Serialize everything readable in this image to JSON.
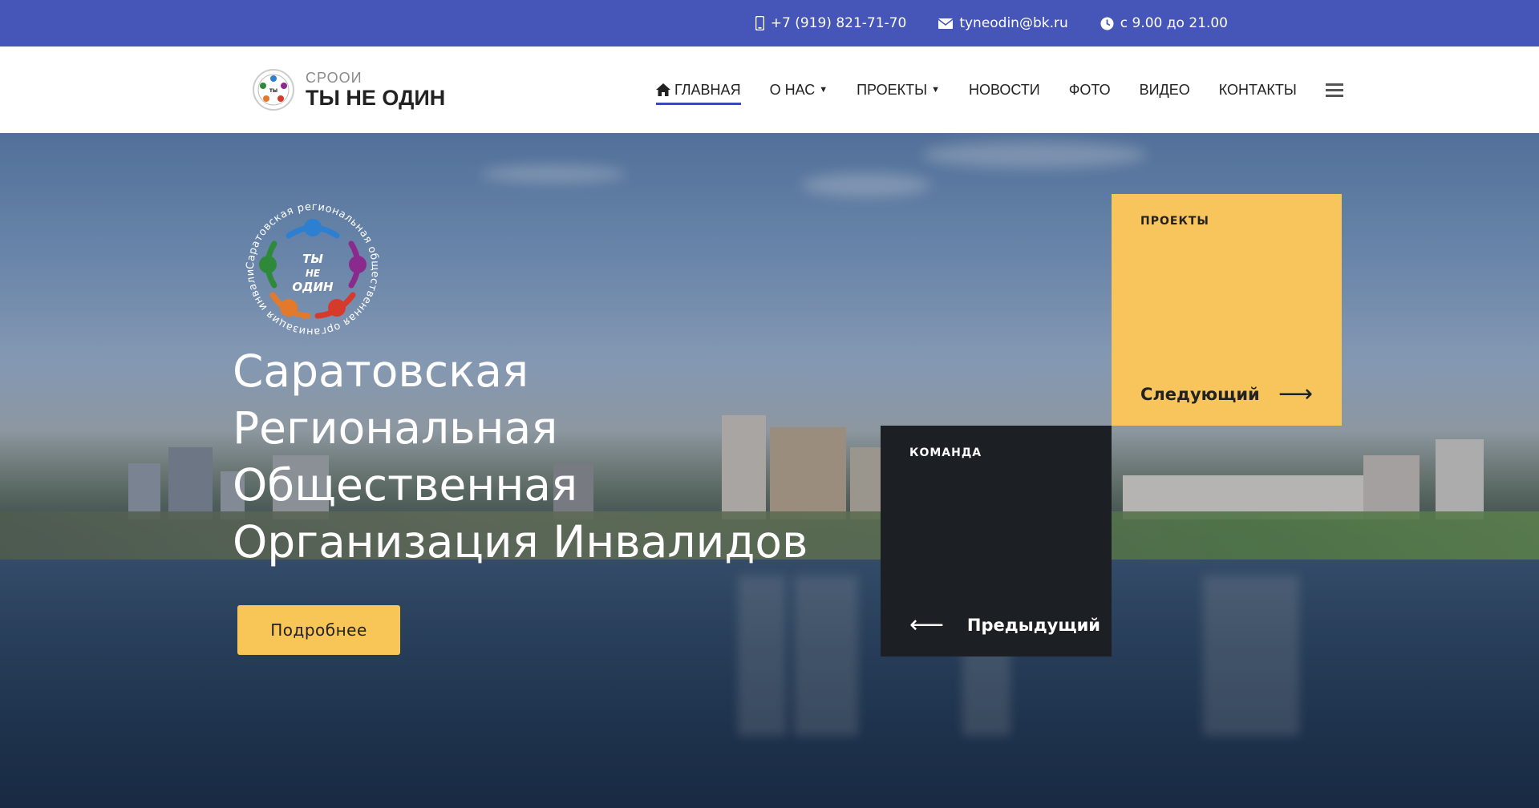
{
  "topbar": {
    "phone": "+7 (919) 821-71-70",
    "email": "tyneodin@bk.ru",
    "hours": "с 9.00 до 21.00"
  },
  "brand": {
    "small": "СРООИ",
    "big": "ТЫ НЕ ОДИН"
  },
  "nav": {
    "items": [
      {
        "label": "ГЛАВНАЯ",
        "icon": "home-icon",
        "active": true
      },
      {
        "label": "О НАС",
        "dropdown": true
      },
      {
        "label": "ПРОЕКТЫ",
        "dropdown": true
      },
      {
        "label": "НОВОСТИ"
      },
      {
        "label": "ФОТО"
      },
      {
        "label": "ВИДЕО"
      },
      {
        "label": "КОНТАКТЫ"
      }
    ],
    "menu_icon": "hamburger-menu-icon"
  },
  "hero": {
    "emblem": {
      "ring_text": "Саратовская региональная общественная организация инвалидов",
      "center_text": [
        "ТЫ",
        "НЕ",
        "ОДИН"
      ]
    },
    "title_lines": [
      "Саратовская",
      "Региональная",
      "Общественная",
      "Организация Инвалидов"
    ],
    "button_label": "Подробнее"
  },
  "slides": {
    "next": {
      "label": "ПРОЕКТЫ",
      "link": "Следующий",
      "arrow": "⟶"
    },
    "prev": {
      "label": "КОМАНДА",
      "link": "Предыдущий",
      "arrow": "⟵"
    }
  },
  "colors": {
    "topbar": "#4655b8",
    "accent_yellow": "#f8c55c",
    "card_dark": "#1c1f24",
    "nav_active_underline": "#3a4ab0"
  }
}
